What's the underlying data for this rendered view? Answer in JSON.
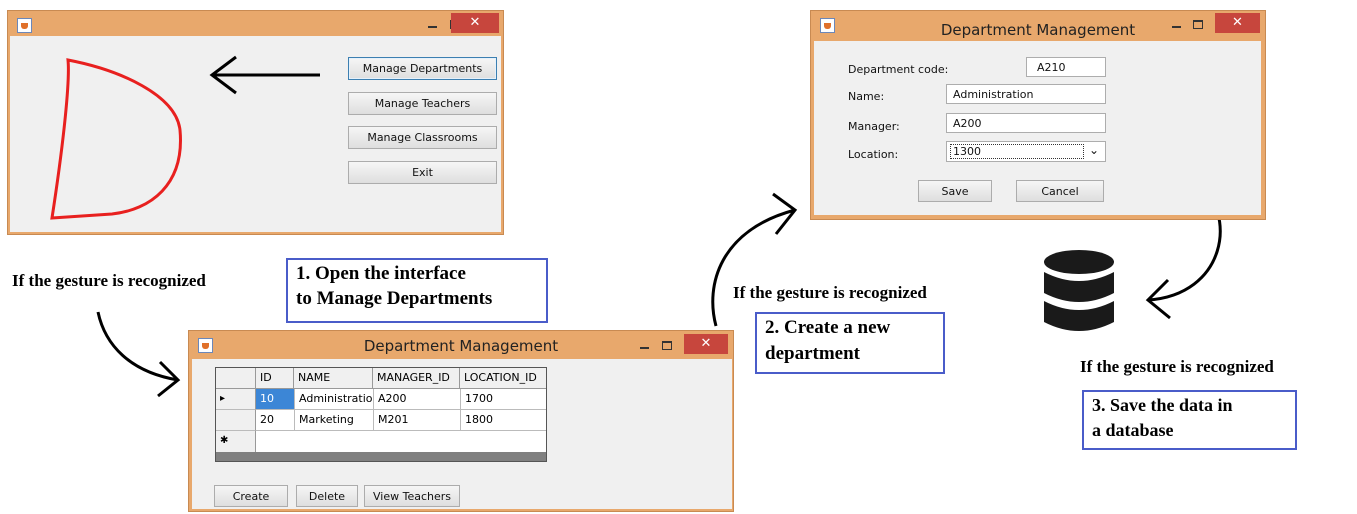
{
  "step_label_text": "If the gesture is recognized",
  "main_window": {
    "buttons": [
      "Manage Departments",
      "Manage Teachers",
      "Manage Classrooms",
      "Exit"
    ],
    "close_glyph": "✕"
  },
  "step1": {
    "line1": "1. Open the interface",
    "line2": "to Manage Departments"
  },
  "list_window": {
    "title": "Department Management",
    "columns": [
      "ID",
      "NAME",
      "MANAGER_ID",
      "LOCATION_ID"
    ],
    "rows": [
      [
        "10",
        "Administratior",
        "A200",
        "1700"
      ],
      [
        "20",
        "Marketing",
        "M201",
        "1800"
      ]
    ],
    "row_pointer": "▸",
    "new_row_marker": "✱",
    "buttons": [
      "Create",
      "Delete",
      "View Teachers"
    ]
  },
  "step2": {
    "line1": "2. Create a new",
    "line2": "department"
  },
  "form_window": {
    "title": "Department Management",
    "labels": [
      "Department code:",
      "Name:",
      "Manager:",
      "Location:"
    ],
    "values": {
      "code": "A210",
      "name": "Administration",
      "manager": "A200",
      "location": "1300"
    },
    "dropdown_glyph": "⌄",
    "buttons": [
      "Save",
      "Cancel"
    ]
  },
  "step3": {
    "line1": "3. Save the data in",
    "line2": "a database"
  },
  "colors": {
    "gesture_stroke": "#e8201f",
    "highlight_box": "#4a5cc9",
    "window_frame": "#e8a86c"
  }
}
